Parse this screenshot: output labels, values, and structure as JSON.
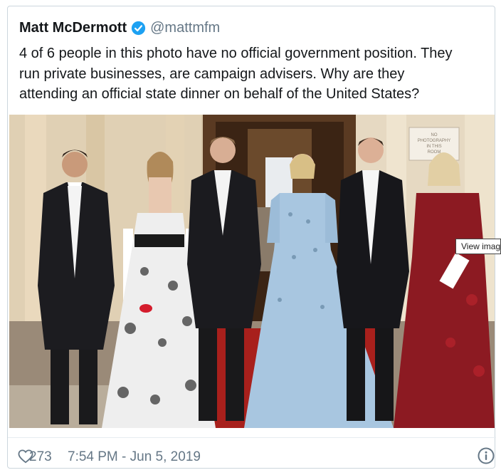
{
  "tweet": {
    "author_name": "Matt McDermott",
    "handle": "@mattmfm",
    "text_lines": [
      "4 of 6 people in this photo have no official government position. They",
      "run private businesses, are campaign advisers. Why are they",
      "attending an official state dinner on behalf of the United States?"
    ],
    "likes": "273",
    "timestamp": "7:54 PM - Jun 5, 2019"
  },
  "photo": {
    "sign_text": [
      "NO",
      "PHOTOGRAPHY",
      "IN THIS",
      "ROOM"
    ]
  },
  "tooltip": {
    "label": "View imag"
  },
  "icons": {
    "verified": "verified-badge-icon",
    "like": "heart-icon",
    "info": "info-icon"
  },
  "colors": {
    "verified_blue": "#1da1f2",
    "secondary_text": "#657786",
    "border": "#ccd6dd"
  }
}
